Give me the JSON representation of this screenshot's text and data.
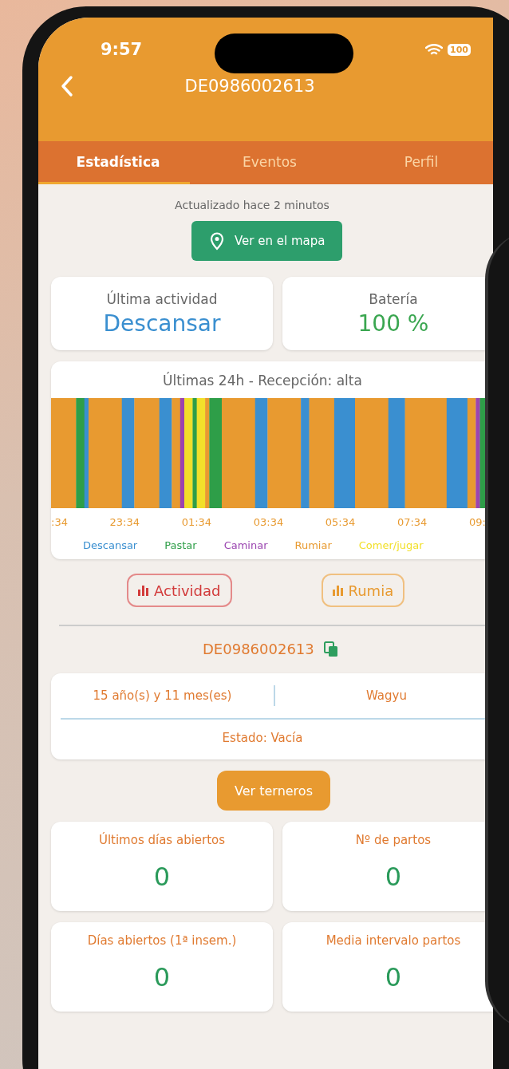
{
  "status_bar": {
    "time": "9:57",
    "battery": "100"
  },
  "header": {
    "title": "DE0986002613"
  },
  "tabs": [
    {
      "label": "Estadística",
      "selected": true
    },
    {
      "label": "Eventos",
      "selected": false
    },
    {
      "label": "Perfil",
      "selected": false
    }
  ],
  "updated": "Actualizado hace 2 minutos",
  "map_button": "Ver en el mapa",
  "summary": [
    {
      "label": "Última actividad",
      "value": "Descansar",
      "kind": "activity"
    },
    {
      "label": "Batería",
      "value": "100 %",
      "kind": "battery"
    }
  ],
  "activity_chart": {
    "title": "Últimas 24h - Recepción: alta",
    "times": [
      ":34",
      "23:34",
      "01:34",
      "03:34",
      "05:34",
      "07:34",
      "09:"
    ],
    "legend": [
      {
        "label": "Descansar",
        "color": "#3a8fd0"
      },
      {
        "label": "Pastar",
        "color": "#2e9e48"
      },
      {
        "label": "Caminar",
        "color": "#9b45b0"
      },
      {
        "label": "Rumiar",
        "color": "#e89a30"
      },
      {
        "label": "Comer/jugar",
        "color": "#f2e02a"
      }
    ]
  },
  "chart_buttons": [
    {
      "label": "Actividad",
      "kind": "activity"
    },
    {
      "label": "Rumia",
      "kind": "rumination"
    }
  ],
  "animal_id": "DE0986002613",
  "info": {
    "age": "15 año(s) y 11 mes(es)",
    "breed": "Wagyu",
    "status": "Estado: Vacía"
  },
  "calves_button": "Ver terneros",
  "stats": [
    {
      "label": "Últimos días abiertos",
      "value": "0"
    },
    {
      "label": "Nº de partos",
      "value": "0"
    },
    {
      "label": "Días abiertos (1ª insem.)",
      "value": "0"
    },
    {
      "label": "Media intervalo partos",
      "value": "0"
    }
  ]
}
